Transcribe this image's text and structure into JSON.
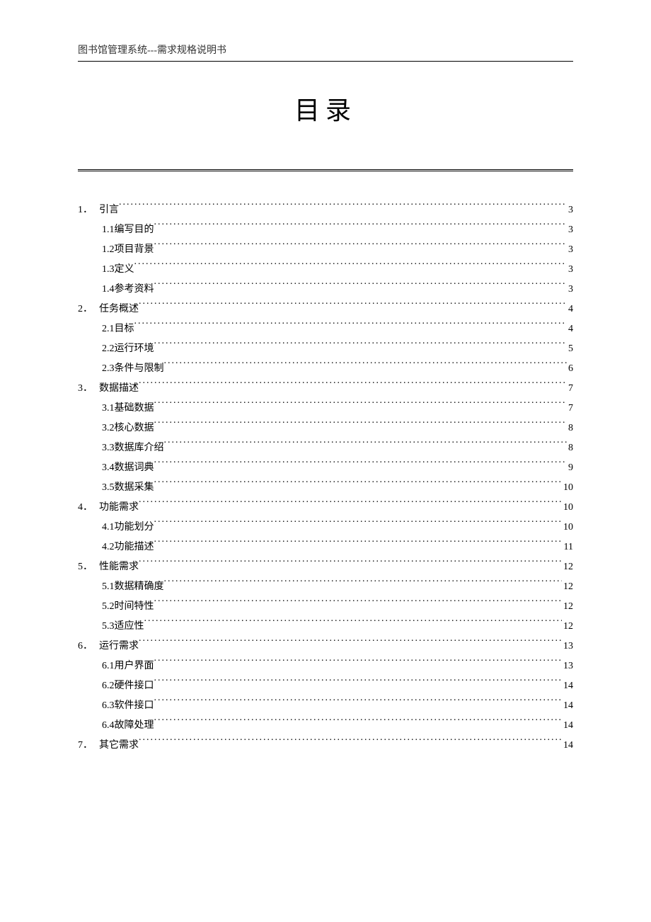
{
  "header": "图书馆管理系统---需求规格说明书",
  "title": "目录",
  "toc": [
    {
      "level": 1,
      "num": "1．",
      "label": "引言",
      "page": "3"
    },
    {
      "level": 2,
      "num": "1.1 ",
      "label": "编写目的",
      "page": "3"
    },
    {
      "level": 2,
      "num": "1.2 ",
      "label": "项目背景",
      "page": "3"
    },
    {
      "level": 2,
      "num": "1.3 ",
      "label": "定义",
      "page": "3"
    },
    {
      "level": 2,
      "num": "1.4 ",
      "label": "参考资料",
      "page": "3"
    },
    {
      "level": 1,
      "num": "2．",
      "label": "任务概述",
      "page": "4"
    },
    {
      "level": 2,
      "num": "2.1 ",
      "label": "目标",
      "page": "4"
    },
    {
      "level": 2,
      "num": "2.2 ",
      "label": "运行环境",
      "page": "5"
    },
    {
      "level": 2,
      "num": "2.3 ",
      "label": "条件与限制",
      "page": "6"
    },
    {
      "level": 1,
      "num": "3．",
      "label": "数据描述",
      "page": "7"
    },
    {
      "level": 2,
      "num": "3.1 ",
      "label": "基础数据",
      "page": "7"
    },
    {
      "level": 2,
      "num": "3.2 ",
      "label": "核心数据",
      "page": "8"
    },
    {
      "level": 2,
      "num": "3.3 ",
      "label": "数据库介绍",
      "page": "8"
    },
    {
      "level": 2,
      "num": "3.4 ",
      "label": "数据词典",
      "page": "9"
    },
    {
      "level": 2,
      "num": "3.5 ",
      "label": "数据采集",
      "page": "10"
    },
    {
      "level": 1,
      "num": "4．",
      "label": "功能需求",
      "page": "10"
    },
    {
      "level": 2,
      "num": "4.1 ",
      "label": "功能划分",
      "page": "10"
    },
    {
      "level": 2,
      "num": "4.2 ",
      "label": "功能描述",
      "page": "11"
    },
    {
      "level": 1,
      "num": "5．",
      "label": "性能需求",
      "page": "12"
    },
    {
      "level": 2,
      "num": "5.1 ",
      "label": "数据精确度",
      "page": "12"
    },
    {
      "level": 2,
      "num": "5.2 ",
      "label": "时间特性",
      "page": "12"
    },
    {
      "level": 2,
      "num": "5.3 ",
      "label": "适应性",
      "page": "12"
    },
    {
      "level": 1,
      "num": "6．",
      "label": "运行需求",
      "page": "13"
    },
    {
      "level": 2,
      "num": "6.1 ",
      "label": "用户界面",
      "page": "13"
    },
    {
      "level": 2,
      "num": "6.2 ",
      "label": "硬件接口",
      "page": "14"
    },
    {
      "level": 2,
      "num": "6.3 ",
      "label": "软件接口",
      "page": "14"
    },
    {
      "level": 2,
      "num": "6.4 ",
      "label": "故障处理",
      "page": "14"
    },
    {
      "level": 1,
      "num": "7．",
      "label": "其它需求",
      "page": "14"
    }
  ]
}
